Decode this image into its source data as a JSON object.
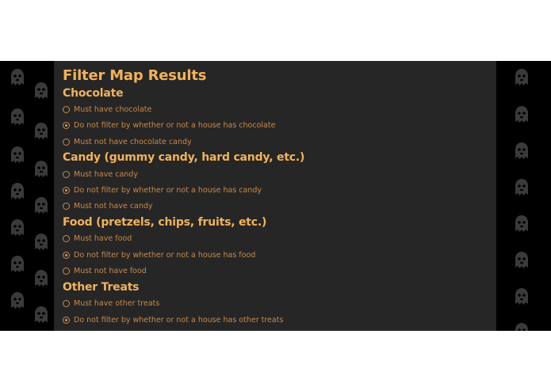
{
  "page": {
    "title": "Filter Map Results"
  },
  "groups": [
    {
      "heading": "Chocolate",
      "options": [
        {
          "label": "Must have chocolate",
          "checked": false
        },
        {
          "label": "Do not filter by whether or not a house has chocolate",
          "checked": true
        },
        {
          "label": "Must not have chocolate candy",
          "checked": false
        }
      ]
    },
    {
      "heading": "Candy (gummy candy, hard candy, etc.)",
      "options": [
        {
          "label": "Must have candy",
          "checked": false
        },
        {
          "label": "Do not filter by whether or not a house has candy",
          "checked": true
        },
        {
          "label": "Must not have candy",
          "checked": false
        }
      ]
    },
    {
      "heading": "Food (pretzels, chips, fruits, etc.)",
      "options": [
        {
          "label": "Must have food",
          "checked": false
        },
        {
          "label": "Do not filter by whether or not a house has food",
          "checked": true
        },
        {
          "label": "Must not have food",
          "checked": false
        }
      ]
    },
    {
      "heading": "Other Treats",
      "options": [
        {
          "label": "Must have other treats",
          "checked": false
        },
        {
          "label": "Do not filter by whether or not a house has other treats",
          "checked": true
        }
      ]
    }
  ],
  "theme": {
    "heading_color": "#f2b25a",
    "option_color": "#c98a4a",
    "panel_bg": "#262626",
    "backdrop_bg": "#000000",
    "backdrop_icon": "ghost-icon"
  }
}
